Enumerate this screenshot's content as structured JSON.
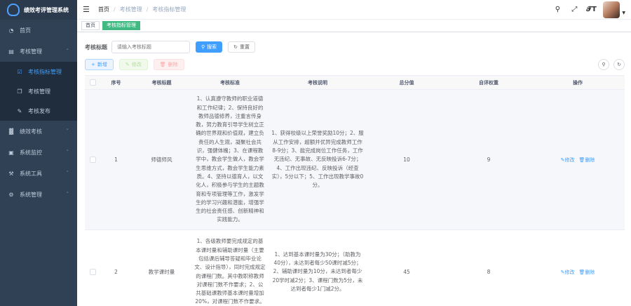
{
  "app": {
    "title": "绩效考评管理系统"
  },
  "sidebar": {
    "items": [
      {
        "label": "首页",
        "icon": "dashboard-icon",
        "kind": "top"
      },
      {
        "label": "考核管理",
        "icon": "folder-icon",
        "kind": "top",
        "expanded": true
      },
      {
        "label": "考核指标管理",
        "icon": "checkbox-icon",
        "kind": "sub",
        "active": true
      },
      {
        "label": "考核管理",
        "icon": "copy-icon",
        "kind": "sub"
      },
      {
        "label": "考核发布",
        "icon": "edit-icon",
        "kind": "sub"
      },
      {
        "label": "绩效考核",
        "icon": "chart-icon",
        "kind": "top"
      },
      {
        "label": "系统监控",
        "icon": "monitor-icon",
        "kind": "top"
      },
      {
        "label": "系统工具",
        "icon": "tool-icon",
        "kind": "top"
      },
      {
        "label": "系统管理",
        "icon": "gear-icon",
        "kind": "top"
      }
    ]
  },
  "header": {
    "breadcrumb": [
      "首页",
      "考核管理",
      "考核指标管理"
    ]
  },
  "tags": [
    "首页",
    "考核指标管理"
  ],
  "search": {
    "label": "考核标题",
    "placeholder": "请输入考核标题",
    "search_label": "搜索",
    "reset_label": "重置"
  },
  "actions": {
    "add_label": "新增",
    "edit_label": "修改",
    "delete_label": "删除"
  },
  "table": {
    "headers": {
      "no": "序号",
      "title": "考核标题",
      "standard": "考核标准",
      "desc": "考核说明",
      "total": "总分值",
      "weight": "自评权重",
      "ops": "操作"
    },
    "rows": [
      {
        "no": "1",
        "title": "师德师风",
        "standard": "1、认真遵守教师的职业道德和工作纪律；2、保持良好的教师品德修养，注重言传身教，努力教育引导学生树立正确的世界观和价值观，建立负责任的人生观，凝聚社会共识，强健体魄；3、在课程教学中，教会学生做人，教会学生思维方式，教会学生能力素质。4、坚持以德育人，以文化人，积极参与学生的主题教育和专项管理等工作，激发学生的学习兴趣和潜能，增强学生的社会责任感、创新精神和实践能力。",
        "desc": "1、获得校级以上荣誉奖励10分；2、服从工作安排，超额并优异完成教师工作8-9分；3、能完成岗位工作任务，工作无违纪、无事故、无反映投诉6-7分；4、工作出现违纪、反映投诉（经查实），5分以下；5、工作出现教学事故0分。",
        "total": "10",
        "weight": "9",
        "edit": "修改",
        "delete": "删除"
      },
      {
        "no": "2",
        "title": "教学课时量",
        "standard": "1、各级教师要完成规定的基本课时量和辅助课时量（主要包括课后辅导答疑和毕业论文、设计指导），同时完成规定的课程门数。其中教职称教师对课程门数不作要求；2、公共基础课教师基本课时量增加20%，对课程门数不作要求。",
        "desc": "1、达到基本课时量为30分；（助教为40分），未达到者每少50课时减5分；2、辅助课时量为10分，未达到者每少20学时减2分；3、课程门数为5分，未达到者每少1门减2分。",
        "total": "45",
        "weight": "8",
        "edit": "修改",
        "delete": "删除"
      }
    ]
  }
}
